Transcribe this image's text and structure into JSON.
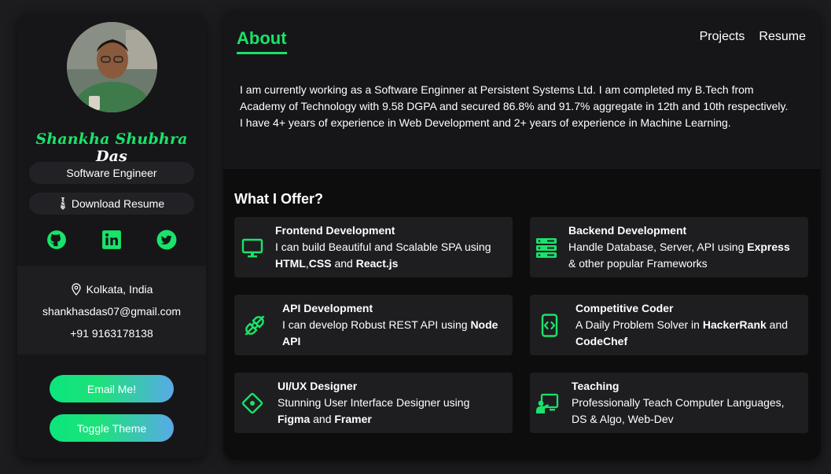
{
  "profile": {
    "first_name": "Shankha Shubhra",
    "last_name": "Das",
    "role": "Software Engineer",
    "download_label": "Download Resume",
    "location": "Kolkata, India",
    "email": "shankhasdas07@gmail.com",
    "phone": "+91 9163178138",
    "socials": [
      "github-icon",
      "linkedin-icon",
      "twitter-icon"
    ]
  },
  "buttons": {
    "email": "Email Me!",
    "theme": "Toggle Theme"
  },
  "nav": {
    "active": "About",
    "projects": "Projects",
    "resume": "Resume"
  },
  "about": {
    "text": "I am currently working as a Software Enginner at Persistent Systems Ltd. I am completed my B.Tech from Academy of Technology with 9.58 DGPA and secured 86.8% and 91.7% aggregate in 12th and 10th respectively. I have 4+ years of experience in Web Development and 2+ years of experience in Machine Learning."
  },
  "offer": {
    "title": "What I Offer?",
    "cards": [
      {
        "icon": "monitor-icon",
        "title": "Frontend Development",
        "line1": "I can build Beautiful and Scalable SPA using",
        "b1": "HTML",
        "t2": ",",
        "b2": "CSS",
        "t3": " and ",
        "b3": "React.js"
      },
      {
        "icon": "server-icon",
        "title": "Backend Development",
        "t1": "Handle Database, Server, API using ",
        "b1": "Express",
        "t2": "& other popular Frameworks"
      },
      {
        "icon": "plug-icon",
        "title": "API Development",
        "t1": "I can develop Robust REST API using ",
        "b1": "Node",
        "b2": "API"
      },
      {
        "icon": "code-phone-icon",
        "title": "Competitive Coder",
        "t1": "A Daily Problem Solver in ",
        "b1": "HackerRank",
        "t2": " and",
        "b2": "CodeChef"
      },
      {
        "icon": "design-pen-icon",
        "title": "UI/UX Designer",
        "t1": "Stunning User Interface Designer using",
        "b1": "Figma",
        "t2": " and ",
        "b2": "Framer"
      },
      {
        "icon": "teacher-icon",
        "title": "Teaching",
        "t1": "Professionally Teach Computer Languages,",
        "t2": "DS & Algo, Web-Dev"
      }
    ]
  },
  "colors": {
    "accent": "#19e36a",
    "bg": "#1c1c1f",
    "panel": "#161618",
    "card": "#1e1e21"
  }
}
